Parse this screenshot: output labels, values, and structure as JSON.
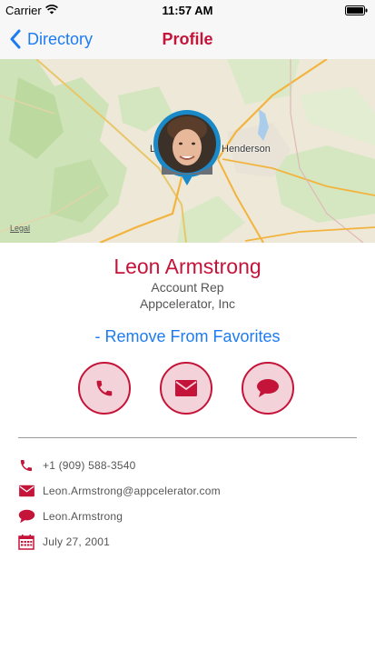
{
  "status_bar": {
    "carrier": "Carrier",
    "time": "11:57 AM"
  },
  "nav": {
    "back_label": "Directory",
    "title": "Profile"
  },
  "map": {
    "city_label": "Henderson",
    "partial_label": "L",
    "legal_label": "Legal"
  },
  "profile": {
    "name": "Leon Armstrong",
    "title": "Account Rep",
    "company": "Appcelerator, Inc",
    "favorites_action": "- Remove From Favorites"
  },
  "actions": {
    "call_icon": "phone-icon",
    "email_icon": "envelope-icon",
    "message_icon": "speech-bubble-icon"
  },
  "details": {
    "phone": "+1 (909) 588-3540",
    "email": "Leon.Armstrong@appcelerator.com",
    "chat": "Leon.Armstrong",
    "date": "July 27, 2001"
  },
  "colors": {
    "accent": "#c5143a",
    "link": "#1e7bf0",
    "button_fill": "#f3d3d9"
  }
}
